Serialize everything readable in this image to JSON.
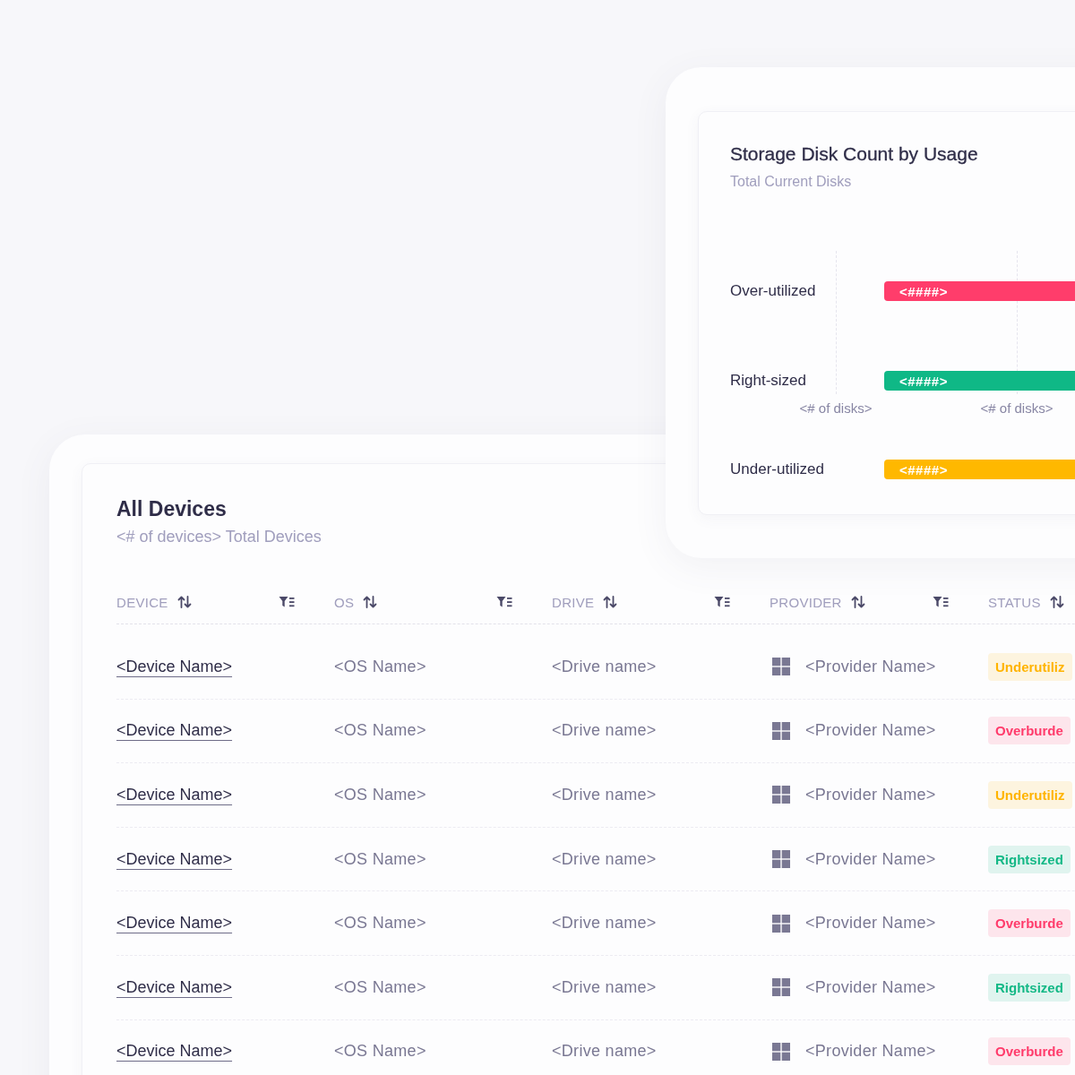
{
  "devices_card": {
    "title": "All Devices",
    "subtitle": "<# of devices> Total Devices",
    "columns": [
      "DEVICE",
      "OS",
      "DRIVE",
      "PROVIDER",
      "STATUS"
    ],
    "rows": [
      {
        "device": "<Device Name>",
        "os": "<OS Name>",
        "drive": "<Drive name>",
        "provider": "<Provider Name>",
        "status": {
          "text": "Underutiliz",
          "color": "#ffb400"
        }
      },
      {
        "device": "<Device Name>",
        "os": "<OS Name>",
        "drive": "<Drive name>",
        "provider": "<Provider Name>",
        "status": {
          "text": "Overburde",
          "color": "#ff3b6b"
        }
      },
      {
        "device": "<Device Name>",
        "os": "<OS Name>",
        "drive": "<Drive name>",
        "provider": "<Provider Name>",
        "status": {
          "text": "Underutiliz",
          "color": "#ffb400"
        }
      },
      {
        "device": "<Device Name>",
        "os": "<OS Name>",
        "drive": "<Drive name>",
        "provider": "<Provider Name>",
        "status": {
          "text": "Rightsized",
          "color": "#14b886"
        }
      },
      {
        "device": "<Device Name>",
        "os": "<OS Name>",
        "drive": "<Drive name>",
        "provider": "<Provider Name>",
        "status": {
          "text": "Overburde",
          "color": "#ff3b6b"
        }
      },
      {
        "device": "<Device Name>",
        "os": "<OS Name>",
        "drive": "<Drive name>",
        "provider": "<Provider Name>",
        "status": {
          "text": "Rightsized",
          "color": "#14b886"
        }
      },
      {
        "device": "<Device Name>",
        "os": "<OS Name>",
        "drive": "<Drive name>",
        "provider": "<Provider Name>",
        "status": {
          "text": "Overburde",
          "color": "#ff3b6b"
        }
      }
    ]
  },
  "chart_card": {
    "title": "Storage Disk Count by Usage",
    "subtitle": "Total Current Disks",
    "bars": [
      {
        "category": "Over-utilized",
        "value_label": "<####>",
        "color": "#ff3d6b"
      },
      {
        "category": "Right-sized",
        "value_label": "<####>",
        "color": "#0fb886"
      },
      {
        "category": "Under-utilized",
        "value_label": "<####>",
        "color": "#ffb800"
      }
    ],
    "axis_labels": [
      "<# of disks>",
      "<# of disks>"
    ]
  }
}
